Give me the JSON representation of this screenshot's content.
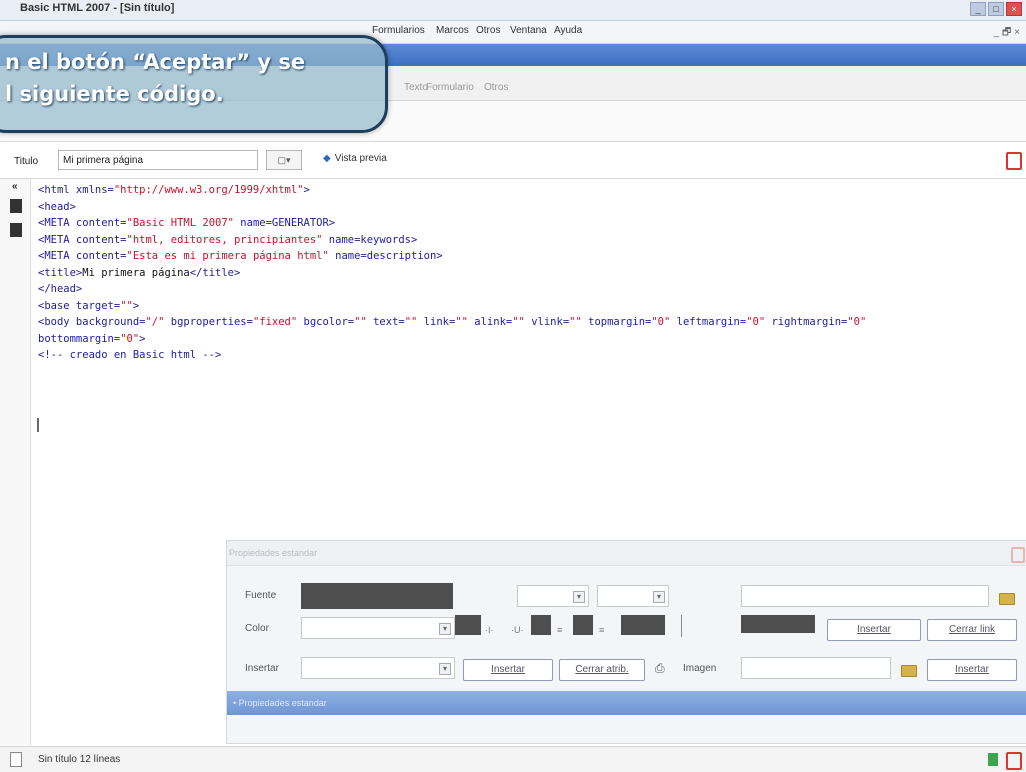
{
  "window": {
    "title": "Basic HTML 2007 - [Sin título]"
  },
  "menu": {
    "items": [
      "Formularios",
      "Marcos",
      "Otros",
      "Ventana",
      "Ayuda"
    ],
    "mdi_controls": "_ 🗗 ×"
  },
  "callout": {
    "line1": "n el botón “Aceptar” y se",
    "line2": "l siguiente código."
  },
  "tabs": [
    "Texto",
    "Formulario",
    "Otros"
  ],
  "titlebar_row": {
    "label": "Titulo",
    "value": "Mi primera página",
    "preview_label": "Vista previa"
  },
  "code": {
    "lines": [
      [
        [
          "t",
          "<html xmlns="
        ],
        [
          "s",
          "\"http://www.w3.org/1999/xhtml\""
        ],
        [
          "t",
          ">"
        ]
      ],
      [
        [
          "t",
          "<head>"
        ]
      ],
      [
        [
          "t",
          "<META content="
        ],
        [
          "s",
          "\"Basic HTML 2007\""
        ],
        [
          "t",
          " name=GENERATOR>"
        ]
      ],
      [
        [
          "t",
          "<META content="
        ],
        [
          "s",
          "\"html, editores, principiantes\""
        ],
        [
          "t",
          " name=keywords>"
        ]
      ],
      [
        [
          "t",
          "<META content="
        ],
        [
          "s",
          "\"Esta es mi primera página html\""
        ],
        [
          "t",
          " name=description>"
        ]
      ],
      [
        [
          "t",
          "<title>"
        ],
        [
          "x",
          "Mi primera página"
        ],
        [
          "t",
          "</title>"
        ]
      ],
      [
        [
          "t",
          "</head>"
        ]
      ],
      [
        [
          "t",
          "<base target="
        ],
        [
          "s",
          "\"\""
        ],
        [
          "t",
          ">"
        ]
      ],
      [
        [
          "t",
          "<body background="
        ],
        [
          "s",
          "\"/\""
        ],
        [
          "t",
          " bgproperties="
        ],
        [
          "s",
          "\"fixed\""
        ],
        [
          "t",
          " bgcolor="
        ],
        [
          "s",
          "\"\""
        ],
        [
          "t",
          " text="
        ],
        [
          "s",
          "\"\""
        ],
        [
          "t",
          " link="
        ],
        [
          "s",
          "\"\""
        ],
        [
          "t",
          " alink="
        ],
        [
          "s",
          "\"\""
        ],
        [
          "t",
          " vlink="
        ],
        [
          "s",
          "\"\""
        ],
        [
          "t",
          " topmargin="
        ],
        [
          "s",
          "\"0\""
        ],
        [
          "t",
          " leftmargin="
        ],
        [
          "s",
          "\"0\""
        ],
        [
          "t",
          " rightmargin="
        ],
        [
          "s",
          "\"0\""
        ]
      ],
      [
        [
          "t",
          "bottommargin="
        ],
        [
          "s",
          "\"0\""
        ],
        [
          "t",
          ">"
        ]
      ],
      [
        [
          "t",
          "<!-- creado en Basic html -->"
        ]
      ]
    ]
  },
  "properties": {
    "header": "Propiedades estandar",
    "font_label": "Fuente",
    "color_label": "Color",
    "insert_label": "Insertar",
    "image_label": "Imagen",
    "insert_button": "Insertar",
    "close_link_button": "Cerrar link",
    "close_attr_button": "Cerrar atrib.",
    "insert_button_2": "Insertar",
    "insert_button_3": "Insertar",
    "footer": "• Propiedades estandar"
  },
  "status": {
    "text": "Sin título   12 líneas"
  }
}
